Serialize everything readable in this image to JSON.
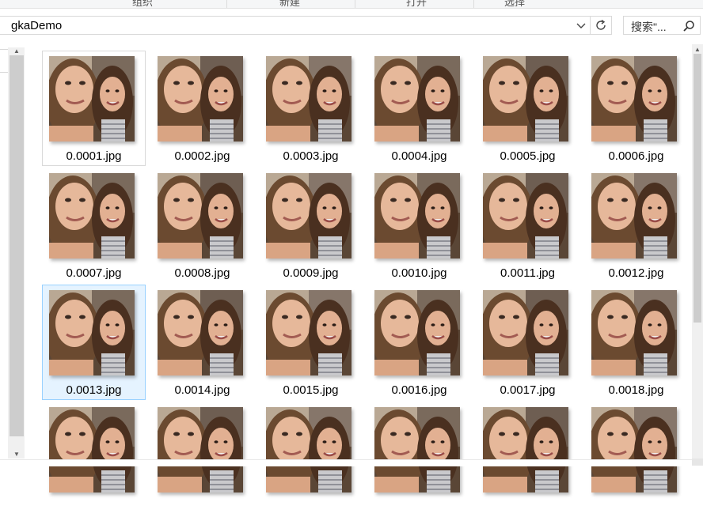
{
  "ribbon": {
    "groups": [
      "组织",
      "新建",
      "打开",
      "选择"
    ]
  },
  "address": {
    "path": "gkaDemo",
    "search_placeholder": "搜索\"..."
  },
  "files": [
    {
      "name": "0.0001.jpg",
      "state": "focused"
    },
    {
      "name": "0.0002.jpg",
      "state": "normal"
    },
    {
      "name": "0.0003.jpg",
      "state": "normal"
    },
    {
      "name": "0.0004.jpg",
      "state": "normal"
    },
    {
      "name": "0.0005.jpg",
      "state": "normal"
    },
    {
      "name": "0.0006.jpg",
      "state": "normal"
    },
    {
      "name": "0.0007.jpg",
      "state": "normal"
    },
    {
      "name": "0.0008.jpg",
      "state": "normal"
    },
    {
      "name": "0.0009.jpg",
      "state": "normal"
    },
    {
      "name": "0.0010.jpg",
      "state": "normal"
    },
    {
      "name": "0.0011.jpg",
      "state": "normal"
    },
    {
      "name": "0.0012.jpg",
      "state": "normal"
    },
    {
      "name": "0.0013.jpg",
      "state": "selected"
    },
    {
      "name": "0.0014.jpg",
      "state": "normal"
    },
    {
      "name": "0.0015.jpg",
      "state": "normal"
    },
    {
      "name": "0.0016.jpg",
      "state": "normal"
    },
    {
      "name": "0.0017.jpg",
      "state": "normal"
    },
    {
      "name": "0.0018.jpg",
      "state": "normal"
    },
    {
      "name": "",
      "state": "normal"
    },
    {
      "name": "",
      "state": "normal"
    },
    {
      "name": "",
      "state": "normal"
    },
    {
      "name": "",
      "state": "normal"
    },
    {
      "name": "",
      "state": "normal"
    },
    {
      "name": "",
      "state": "normal"
    }
  ],
  "icons": {
    "address_dropdown": "chevron-down-icon",
    "refresh": "refresh-icon",
    "search": "search-icon",
    "thumbnail": "photo-thumbnail-icon"
  },
  "colors": {
    "selection_fill": "#e5f3ff",
    "selection_border": "#99d1ff",
    "focus_border": "#d9d9d9",
    "scrollbar_thumb": "#cdcdcd"
  }
}
